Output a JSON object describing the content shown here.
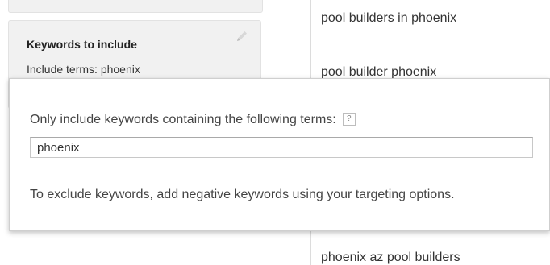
{
  "keywords_card": {
    "title": "Keywords to include",
    "subtitle": "Include terms: phoenix"
  },
  "suggestions": [
    "pool builders in phoenix",
    "pool builder phoenix",
    "phoenix az pool builders"
  ],
  "dialog": {
    "instruction": "Only include keywords containing the following terms:",
    "help_label": "?",
    "input_value": "phoenix",
    "note": "To exclude keywords, add negative keywords using your targeting options."
  },
  "icons": {
    "edit": "pencil-icon",
    "help": "help-icon"
  }
}
